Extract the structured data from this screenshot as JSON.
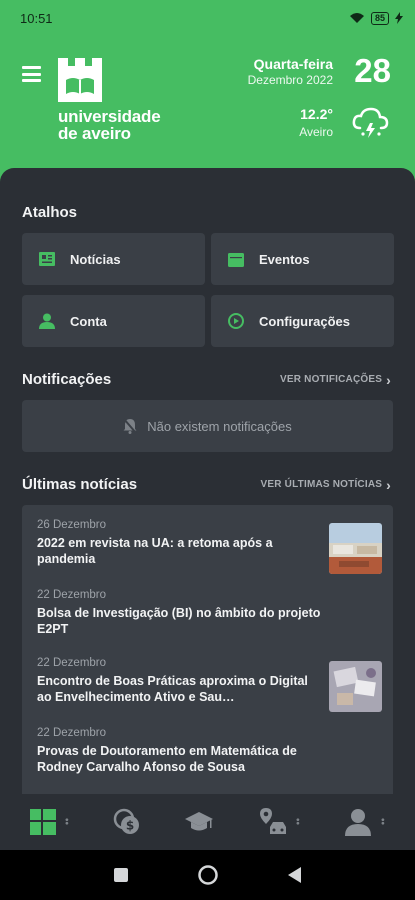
{
  "status_bar": {
    "time": "10:51",
    "battery": "85"
  },
  "header": {
    "brand_line1": "universidade",
    "brand_line2": "de aveiro",
    "weekday": "Quarta-feira",
    "month_year": "Dezembro 2022",
    "day": "28",
    "temperature": "12.2°",
    "city": "Aveiro",
    "accent_color": "#46bd62"
  },
  "shortcuts": {
    "title": "Atalhos",
    "items": [
      {
        "label": "Notícias",
        "icon": "newspaper-icon"
      },
      {
        "label": "Eventos",
        "icon": "calendar-icon"
      },
      {
        "label": "Conta",
        "icon": "person-icon"
      },
      {
        "label": "Configurações",
        "icon": "settings-icon"
      }
    ]
  },
  "notifications": {
    "title": "Notificações",
    "see_more": "VER NOTIFICAÇÕES",
    "empty_text": "Não existem notificações"
  },
  "news": {
    "title": "Últimas notícias",
    "see_more": "VER ÚLTIMAS NOTÍCIAS",
    "items": [
      {
        "date": "26 Dezembro",
        "title": "2022 em revista na UA: a retoma após a pandemia",
        "has_image": true
      },
      {
        "date": "22 Dezembro",
        "title": "Bolsa de Investigação (BI) no âmbito do projeto E2PT",
        "has_image": false
      },
      {
        "date": "22 Dezembro",
        "title": "Encontro de Boas Práticas aproxima o Digital ao Envelhecimento Ativo e Sau…",
        "has_image": true
      },
      {
        "date": "22 Dezembro",
        "title": "Provas de Doutoramento em Matemática de Rodney Carvalho Afonso de Sousa",
        "has_image": false
      }
    ]
  },
  "bottom_nav": [
    "dashboard-icon",
    "money-icon",
    "graduation-cap-icon",
    "map-car-icon",
    "profile-icon"
  ]
}
